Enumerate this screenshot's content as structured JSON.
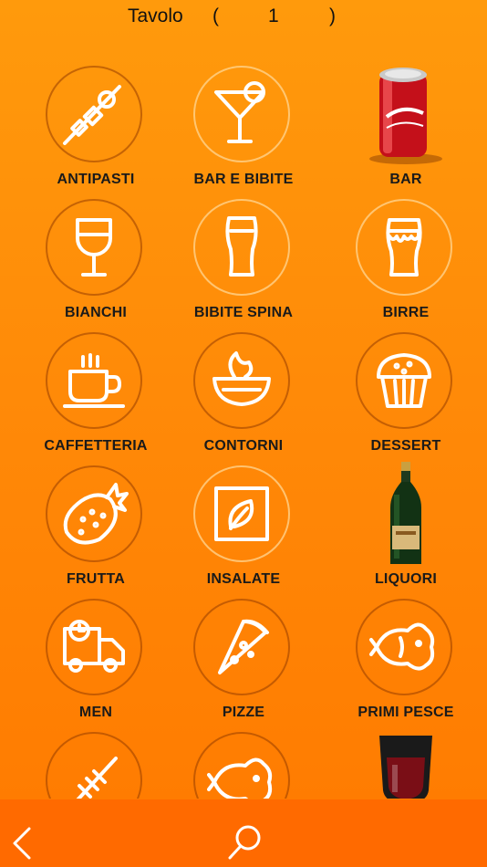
{
  "header": {
    "label": "Tavolo",
    "open_paren": "(",
    "table_number": "1",
    "close_paren": ")"
  },
  "categories": [
    {
      "label": "ANTIPASTI",
      "icon": "skewer-icon"
    },
    {
      "label": "BAR E BIBITE",
      "icon": "cocktail-icon"
    },
    {
      "label": "BAR",
      "icon": "cola-can-icon"
    },
    {
      "label": "BIANCHI",
      "icon": "wine-glass-icon"
    },
    {
      "label": "BIBITE SPINA",
      "icon": "pint-glass-icon"
    },
    {
      "label": "BIRRE",
      "icon": "beer-glass-icon"
    },
    {
      "label": "CAFFETTERIA",
      "icon": "coffee-cup-icon"
    },
    {
      "label": "CONTORNI",
      "icon": "bowl-icon"
    },
    {
      "label": "DESSERT",
      "icon": "muffin-icon"
    },
    {
      "label": "FRUTTA",
      "icon": "strawberry-icon"
    },
    {
      "label": "INSALATE",
      "icon": "leaf-icon"
    },
    {
      "label": "LIQUORI",
      "icon": "bottle-icon"
    },
    {
      "label": "MEN",
      "icon": "delivery-truck-icon"
    },
    {
      "label": "PIZZE",
      "icon": "pizza-slice-icon"
    },
    {
      "label": "PRIMI PESCE",
      "icon": "fish-icon"
    },
    {
      "label": "",
      "icon": "skewer-icon"
    },
    {
      "label": "",
      "icon": "fish-icon"
    },
    {
      "label": "",
      "icon": "wine-glass-photo-icon"
    }
  ],
  "colors": {
    "background": "#ff8a08",
    "bottom_bar": "#ff6a00",
    "icon_stroke": "#ffffff"
  }
}
